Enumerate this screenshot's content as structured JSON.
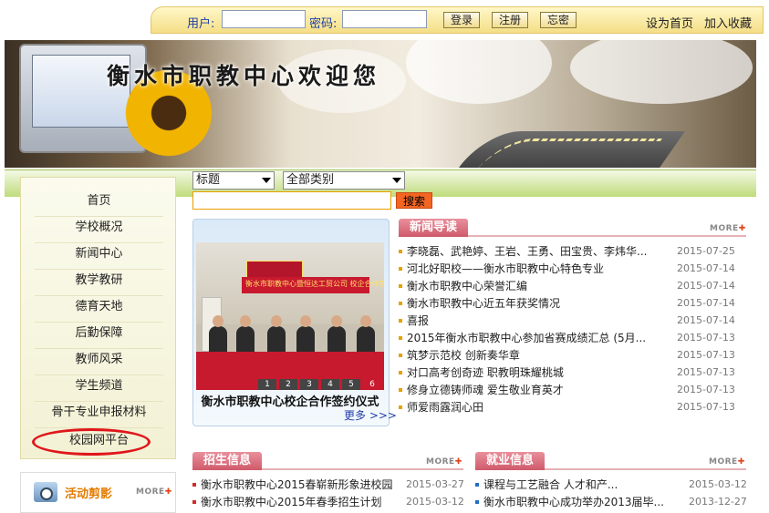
{
  "login": {
    "user_label": "用户:",
    "user_value": "",
    "password_label": "密码:",
    "password_value": "",
    "login_button": "登录",
    "register_button": "注册",
    "forgot_button": "忘密",
    "set_home_link": "设为首页",
    "add_favorite_link": "加入收藏"
  },
  "banner": {
    "title": "衡水市职教中心欢迎您"
  },
  "search": {
    "field_select": "标题",
    "category_select": "全部类别",
    "query_value": "",
    "search_button": "搜索"
  },
  "nav": {
    "items": [
      "首页",
      "学校概况",
      "新闻中心",
      "教学教研",
      "德育天地",
      "后勤保障",
      "教师风采",
      "学生频道",
      "骨干专业申报材料",
      "校园网平台"
    ]
  },
  "activity": {
    "title": "活动剪影",
    "more": "MORE"
  },
  "slideshow": {
    "caption": "衡水市职教中心校企合作签约仪式",
    "more_link": "更多 >>>",
    "pages": [
      "1",
      "2",
      "3",
      "4",
      "5",
      "6"
    ],
    "active_page": "6",
    "photo_banner_text": "衡水市职教中心暨恒达工贸公司 校企合作签约仪式"
  },
  "news": {
    "title": "新闻导读",
    "more": "MORE",
    "items": [
      {
        "text": "李晓磊、武艳婷、王岩、王勇、田宝贵、李炜华...",
        "date": "2015-07-25"
      },
      {
        "text": "河北好职校——衡水市职教中心特色专业",
        "date": "2015-07-14"
      },
      {
        "text": "衡水市职教中心荣誉汇编",
        "date": "2015-07-14"
      },
      {
        "text": "衡水市职教中心近五年获奖情况",
        "date": "2015-07-14"
      },
      {
        "text": "喜报",
        "date": "2015-07-14"
      },
      {
        "text": "2015年衡水市职教中心参加省赛成绩汇总 (5月...",
        "date": "2015-07-13"
      },
      {
        "text": "筑梦示范校 创新奏华章",
        "date": "2015-07-13"
      },
      {
        "text": "对口高考创奇迹 职教明珠耀桃城",
        "date": "2015-07-13"
      },
      {
        "text": "修身立德铸师魂 爱生敬业育英才",
        "date": "2015-07-13"
      },
      {
        "text": "师爱雨露润心田",
        "date": "2015-07-13"
      }
    ]
  },
  "admissions": {
    "title": "招生信息",
    "more": "MORE",
    "items": [
      {
        "text": "衡水市职教中心2015春崭新形象进校园",
        "date": "2015-03-27"
      },
      {
        "text": "衡水市职教中心2015年春季招生计划",
        "date": "2015-03-12"
      }
    ]
  },
  "employment": {
    "title": "就业信息",
    "more": "MORE",
    "items": [
      {
        "text": "课程与工艺融合 人才和产...",
        "date": "2015-03-12"
      },
      {
        "text": "衡水市职教中心成功举办2013届毕...",
        "date": "2013-12-27"
      }
    ]
  },
  "colors": {
    "header_bar": "#f4de86",
    "link_blue": "#1f3fa8",
    "section_tab": "#cf5a6a",
    "search_button": "#f26522",
    "highlight_circle": "#e0161b"
  }
}
